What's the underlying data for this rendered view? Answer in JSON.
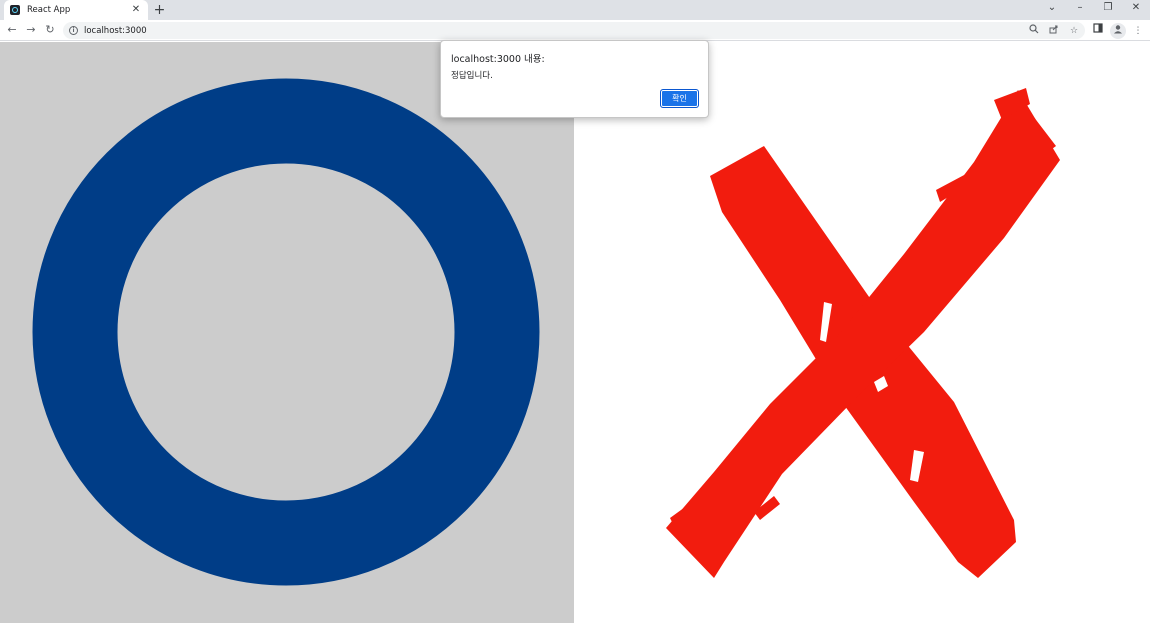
{
  "browser": {
    "tab": {
      "title": "React App",
      "favicon": "react-logo-icon",
      "close": "close-icon"
    },
    "new_tab_icon": "plus-icon",
    "window_controls": [
      "chevron-down-icon",
      "minimize-icon",
      "restore-icon",
      "close-icon"
    ],
    "toolbar": {
      "back_icon": "back-arrow-icon",
      "forward_icon": "forward-arrow-icon",
      "reload_icon": "reload-icon",
      "site_info_icon": "info-icon",
      "url": "localhost:3000",
      "omnibox_icons": [
        "zoom-icon",
        "share-icon",
        "bookmark-star-icon"
      ],
      "right_icons": [
        "side-panel-icon",
        "profile-avatar-icon",
        "menu-kebab-icon"
      ]
    }
  },
  "page": {
    "left_image": {
      "name": "blue-circle-o",
      "ring_color": "#003d87",
      "background": "#cccccc"
    },
    "right_image": {
      "name": "red-brush-x",
      "stroke_color": "#f21c0e",
      "background": "#ffffff"
    }
  },
  "alert": {
    "title": "localhost:3000 내용:",
    "message": "정답입니다.",
    "ok_label": "확인",
    "ok_color": "#1a73e8"
  }
}
